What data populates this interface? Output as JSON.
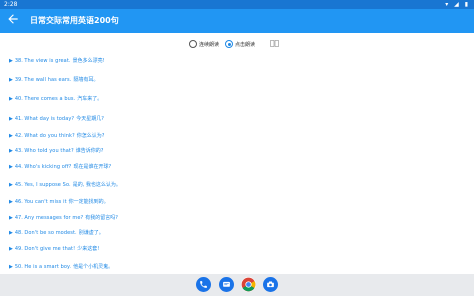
{
  "status_bar": {
    "time": "2:28",
    "icons": "▾ ◢ ▮"
  },
  "app_bar": {
    "title": "日常交际常用英语200句"
  },
  "mode": {
    "sequential_label": "连续朗读",
    "click_label": "点击朗读",
    "selected": "click"
  },
  "sentences": [
    {
      "num": "38.",
      "en": "The view is great.",
      "cn": "景色多么漂亮!"
    },
    {
      "num": "39.",
      "en": "The wall has ears.",
      "cn": "隔墙有耳。"
    },
    {
      "num": "40.",
      "en": "There comes a bus.",
      "cn": "汽车来了。"
    },
    {
      "num": "41.",
      "en": "What day is today?",
      "cn": "今天星期几?"
    },
    {
      "num": "42.",
      "en": "What do you think?",
      "cn": "你怎么认为?"
    },
    {
      "num": "43.",
      "en": "Who told you that?",
      "cn": "谁告诉你的?"
    },
    {
      "num": "44.",
      "en": "Who's kicking off?",
      "cn": "现在是谁在开球?"
    },
    {
      "num": "45.",
      "en": "Yes, I suppose So.",
      "cn": "是的, 我也这么认为。"
    },
    {
      "num": "46.",
      "en": "You can't miss it",
      "cn": "你一定能找到的。"
    },
    {
      "num": "47.",
      "en": "Any messages for me?",
      "cn": "有我的留言吗?"
    },
    {
      "num": "48.",
      "en": "Don't be so modest.",
      "cn": "别谦虚了。"
    },
    {
      "num": "49.",
      "en": "Don't give me that!",
      "cn": "少来这套!"
    },
    {
      "num": "50.",
      "en": "He is a smart boy.",
      "cn": "他是个小机灵鬼。"
    }
  ],
  "dock": {
    "icons": [
      "phone-icon",
      "messages-icon",
      "chrome-icon",
      "camera-icon"
    ]
  },
  "colors": {
    "app_bar": "#2196f3",
    "status_bar": "#1976d2",
    "sentence_text": "#1e88e5"
  }
}
